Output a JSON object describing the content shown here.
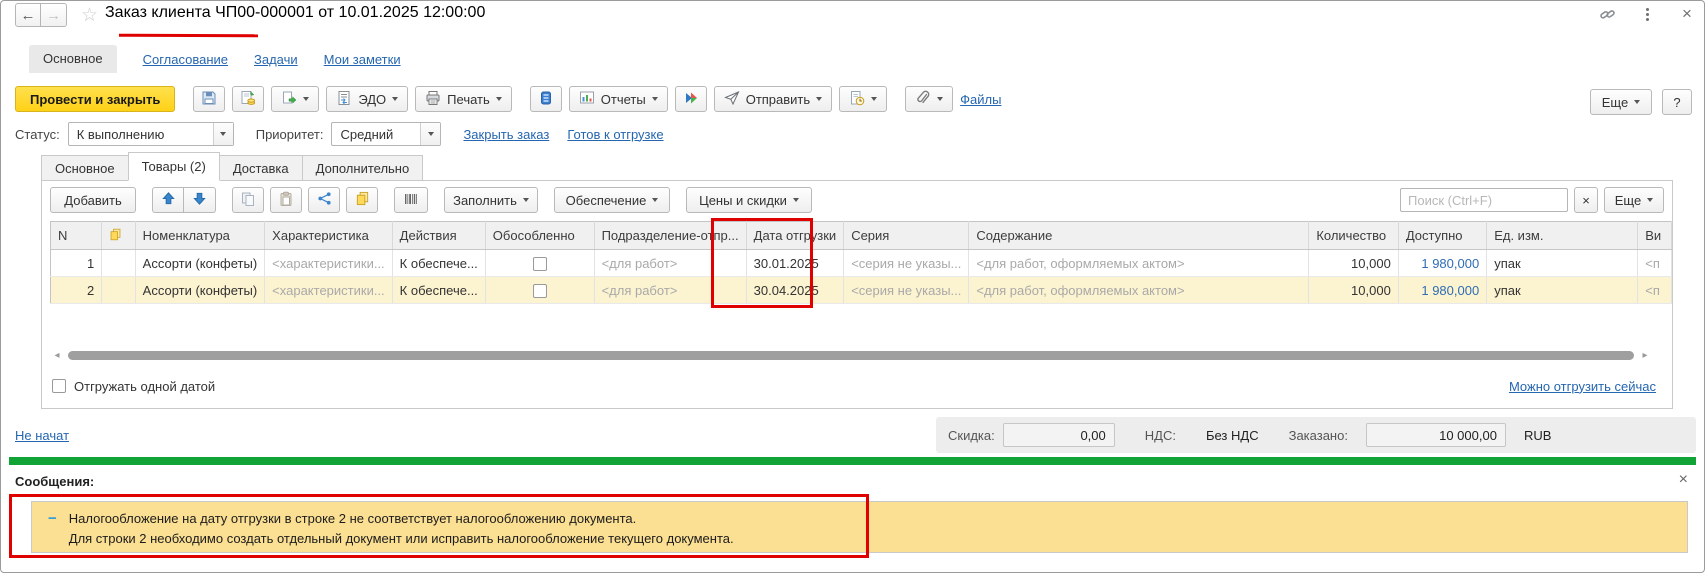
{
  "header": {
    "title": "Заказ клиента ЧП00-000001 от 10.01.2025 12:00:00",
    "nav": {
      "active_tab": "Основное",
      "links": [
        "Согласование",
        "Задачи",
        "Мои заметки"
      ]
    }
  },
  "toolbar": {
    "primary_button": "Провести и закрыть",
    "edo_label": "ЭДО",
    "print_label": "Печать",
    "reports_label": "Отчеты",
    "send_label": "Отправить",
    "files_link": "Файлы",
    "more_label": "Еще",
    "help_label": "?"
  },
  "status_row": {
    "status_label": "Статус:",
    "status_value": "К выполнению",
    "priority_label": "Приоритет:",
    "priority_value": "Средний",
    "links": [
      "Закрыть заказ",
      "Готов к отгрузке"
    ]
  },
  "doc_tabs": {
    "tabs": [
      "Основное",
      "Товары (2)",
      "Доставка",
      "Дополнительно"
    ],
    "active": "Товары (2)"
  },
  "table_toolbar": {
    "add_label": "Добавить",
    "fill_label": "Заполнить",
    "supply_label": "Обеспечение",
    "prices_label": "Цены и скидки",
    "search_placeholder": "Поиск (Ctrl+F)",
    "more_label": "Еще"
  },
  "table": {
    "columns": [
      "N",
      "",
      "Номенклатура",
      "Характеристика",
      "Действия",
      "Обособленно",
      "Подразделение-отпр...",
      "Дата отгрузки",
      "Серия",
      "Содержание",
      "Количество",
      "Доступно",
      "Ед. изм.",
      "Ви"
    ],
    "rows": [
      {
        "n": "1",
        "nomenclature": "Ассорти (конфеты)",
        "characteristic": "<характеристики...",
        "action": "К обеспече...",
        "department": "<для работ>",
        "ship_date": "30.01.2025",
        "series": "<серия не указы...",
        "content": "<для работ, оформляемых актом>",
        "quantity": "10,000",
        "available": "1 980,000",
        "unit": "упак",
        "vid": "<п"
      },
      {
        "n": "2",
        "nomenclature": "Ассорти (конфеты)",
        "characteristic": "<характеристики...",
        "action": "К обеспече...",
        "department": "<для работ>",
        "ship_date": "30.04.2025",
        "series": "<серия не указы...",
        "content": "<для работ, оформляемых актом>",
        "quantity": "10,000",
        "available": "1 980,000",
        "unit": "упак",
        "vid": "<п"
      }
    ]
  },
  "table_footer": {
    "checkbox_label": "Отгружать одной датой",
    "ship_now_link": "Можно отгрузить сейчас"
  },
  "summary": {
    "state_link": "Не начат",
    "discount_label": "Скидка:",
    "discount_value": "0,00",
    "vat_label": "НДС:",
    "vat_value": "Без НДС",
    "ordered_label": "Заказано:",
    "ordered_value": "10 000,00",
    "currency": "RUB"
  },
  "messages": {
    "title": "Сообщения:",
    "line1": "Налогообложение на дату отгрузки в строке 2 не соответствует налогообложению документа.",
    "line2": "Для строки 2 необходимо создать отдельный документ или исправить налогообложение текущего документа."
  },
  "icons": {
    "back": "←",
    "forward": "→",
    "star": "☆",
    "close": "×",
    "hscroll_left": "◂",
    "hscroll_right": "▸",
    "collapse_dash": "−"
  },
  "colors": {
    "accent_yellow": "#ffd117",
    "annotation_red": "#df0000",
    "progress_green": "#12a337",
    "message_bg": "#fbdf92",
    "row_selected": "#fcf3d0",
    "cell_selected": "#f6d88c",
    "link_blue": "#2566b0"
  }
}
